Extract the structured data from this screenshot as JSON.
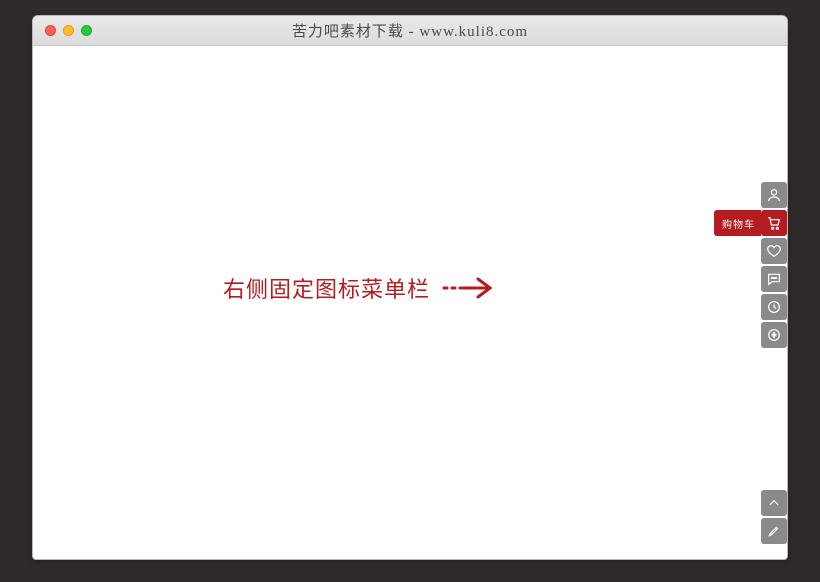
{
  "window": {
    "title": "苦力吧素材下载 - www.kuli8.com"
  },
  "content": {
    "label": "右侧固定图标菜单栏"
  },
  "sidebar": {
    "main": [
      {
        "name": "user",
        "tooltip": null
      },
      {
        "name": "cart",
        "tooltip": "购物车"
      },
      {
        "name": "favorite",
        "tooltip": null
      },
      {
        "name": "chat",
        "tooltip": null
      },
      {
        "name": "history",
        "tooltip": null
      },
      {
        "name": "qrcode",
        "tooltip": null
      }
    ],
    "bottom": [
      {
        "name": "top",
        "tooltip": null
      },
      {
        "name": "edit",
        "tooltip": null
      }
    ]
  }
}
